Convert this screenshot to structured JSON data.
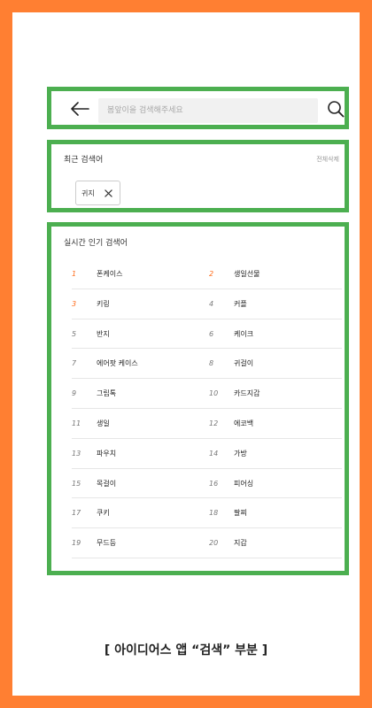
{
  "search": {
    "placeholder": "봄앞이을 검색해주세요"
  },
  "recent": {
    "title": "최근 검색어",
    "delete_all": "전체삭제",
    "chips": [
      {
        "label": "귀지"
      }
    ]
  },
  "popular": {
    "title": "실시간 인기 검색어",
    "items": [
      {
        "rank": "1",
        "label": "폰케이스"
      },
      {
        "rank": "2",
        "label": "생일선물"
      },
      {
        "rank": "3",
        "label": "키링"
      },
      {
        "rank": "4",
        "label": "커플"
      },
      {
        "rank": "5",
        "label": "반지"
      },
      {
        "rank": "6",
        "label": "케이크"
      },
      {
        "rank": "7",
        "label": "에어팟 케이스"
      },
      {
        "rank": "8",
        "label": "귀걸이"
      },
      {
        "rank": "9",
        "label": "그립톡"
      },
      {
        "rank": "10",
        "label": "카드지갑"
      },
      {
        "rank": "11",
        "label": "생일"
      },
      {
        "rank": "12",
        "label": "에코백"
      },
      {
        "rank": "13",
        "label": "파우치"
      },
      {
        "rank": "14",
        "label": "가방"
      },
      {
        "rank": "15",
        "label": "목걸이"
      },
      {
        "rank": "16",
        "label": "피어싱"
      },
      {
        "rank": "17",
        "label": "쿠키"
      },
      {
        "rank": "18",
        "label": "팔찌"
      },
      {
        "rank": "19",
        "label": "무드등"
      },
      {
        "rank": "20",
        "label": "지갑"
      }
    ]
  },
  "caption": "[ 아이디어스 앱 “검색” 부분 ]",
  "colors": {
    "frame": "#ff7f32",
    "highlight_border": "#4caf50",
    "hot_rank": "#ff6b1a"
  },
  "icons": [
    "back-arrow-icon",
    "search-icon",
    "close-icon"
  ]
}
